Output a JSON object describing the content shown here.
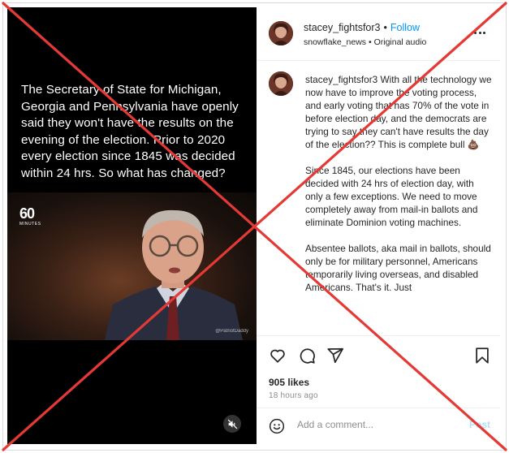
{
  "video": {
    "caption": "The Secretary of State for Michigan, Georgia and Pennsylvania have openly said they won't have the results on the evening of the election. Prior to 2020 every election since 1845 was decided within 24 hrs. So what has changed?",
    "logo_main": "60",
    "logo_sub": "MINUTES",
    "watermark": "@PatriotDaddy"
  },
  "header": {
    "username": "stacey_fightsfor3",
    "dot": "•",
    "follow_label": "Follow",
    "sub_account": "snowflake_news",
    "sub_dot": "•",
    "audio_label": "Original audio"
  },
  "caption": {
    "username": "stacey_fightsfor3",
    "paragraph1": "With all the technology we now have to improve the voting process, and early voting that has 70% of the vote in before election day, and the democrats are trying to say they can't have results the day of the election?? This is complete bull 💩",
    "paragraph2": "Since 1845, our elections have been decided with 24 hrs of election day, with only a few exceptions. We need to move completely away from mail-in ballots and eliminate Dominion voting machines.",
    "paragraph3": "Absentee ballots, aka mail in ballots, should only be for military personnel, Americans temporarily living overseas, and disabled Americans. That's it. Just"
  },
  "engagement": {
    "likes": "905 likes",
    "timestamp": "18 hours ago"
  },
  "comment": {
    "placeholder": "Add a comment...",
    "post_label": "Post"
  },
  "icons": {
    "more": "more-options-icon",
    "like": "heart-icon",
    "comment": "comment-icon",
    "share": "share-icon",
    "save": "bookmark-icon",
    "emoji": "emoji-icon",
    "mute": "mute-icon"
  },
  "colors": {
    "accent": "#0095f6",
    "overlay_x": "#e53935",
    "muted_text": "#8e8e8e"
  }
}
